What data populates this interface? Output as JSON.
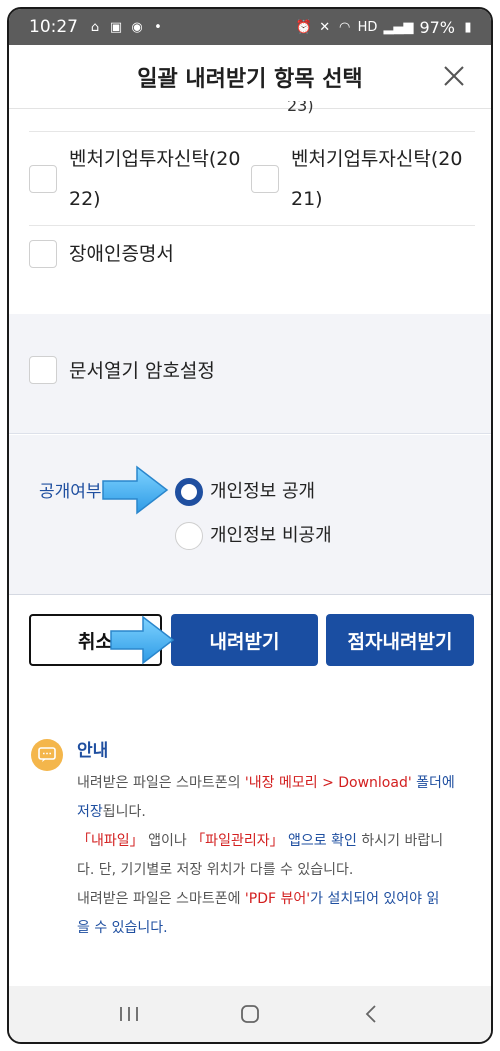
{
  "status_bar": {
    "time": "10:27",
    "left_icons": [
      "home-status-icon",
      "image-status-icon",
      "chat-status-icon",
      "dot-icon"
    ],
    "right_icons": [
      "alarm-icon",
      "mute-icon",
      "wifi-icon",
      "hd-icon",
      "signal-icon"
    ],
    "battery": "97%"
  },
  "header": {
    "title": "일괄 내려받기 항목 선택",
    "close_icon": "close-icon"
  },
  "items": {
    "partial_label": "23)",
    "item1_label_line1": "벤처기업투자신탁(20",
    "item1_label_line2": "22)",
    "item2_label_line1": "벤처기업투자신탁(20",
    "item2_label_line2": "21)",
    "item3_label": "장애인증명서"
  },
  "password_option": {
    "label": "문서열기 암호설정",
    "checked": false
  },
  "disclosure": {
    "label": "공개여부",
    "options": [
      "개인정보 공개",
      "개인정보 비공개"
    ],
    "selected": "개인정보 공개"
  },
  "buttons": {
    "cancel": "취소",
    "download": "내려받기",
    "braille_download": "점자내려받기"
  },
  "notice": {
    "title": "안내",
    "line1_a": "내려받은 파일은 스마트폰의 ",
    "line1_b": "'내장 메모리 > Download'",
    "line1_c": " 폴더에",
    "line2_a": "저장",
    "line2_b": "됩니다.",
    "line3_a": "「내파일」",
    "line3_b": " 앱이나 ",
    "line3_c": "「파일관리자」",
    "line3_d": " 앱으로 확인",
    "line3_e": " 하시기 바랍니",
    "line4": "다. 단, 기기별로 저장 위치가 다를 수 있습니다.",
    "line5_a": "내려받은 파일은 스마트폰에 ",
    "line5_b": "'PDF 뷰어'",
    "line5_c": "가 설치되어 있어야 읽",
    "line6": "을 수 있습니다."
  },
  "colors": {
    "primary": "#1a4ea2",
    "accent_red": "#d32020",
    "notice_icon": "#f4b64b",
    "panel": "#f3f4f8"
  }
}
